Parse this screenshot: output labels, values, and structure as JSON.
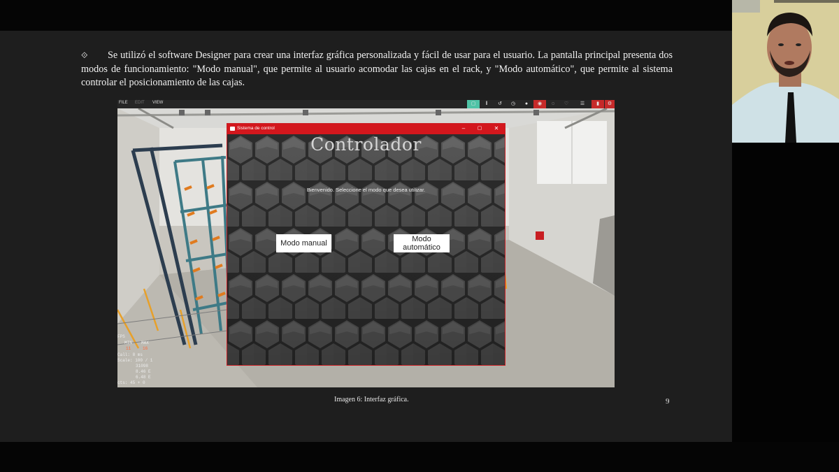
{
  "slide": {
    "bullet_symbol": "⟐",
    "paragraph": "Se utilizó el software Designer para crear una interfaz gráfica personalizada y fácil de usar para el usuario. La pantalla principal presenta dos modos de funcionamiento: \"Modo manual\", que permite al usuario acomodar las cajas en el rack, y \"Modo automático\", que permite al sistema controlar el posicionamiento de las cajas.",
    "caption": "Imagen 6: Interfaz gráfica.",
    "page_number": "9"
  },
  "simulator": {
    "menu": [
      "FILE",
      "EDIT",
      "VIEW"
    ],
    "toolbar_icons": [
      "select-icon",
      "pause-icon",
      "reset-icon",
      "timer-icon",
      "camera-icon",
      "io-icon",
      "sensor-icon",
      "heart-icon",
      "list-icon",
      "settings-icon"
    ],
    "stats": {
      "title": "FPS",
      "min_label": "MIN",
      "max_label": "MAX",
      "min_value": "11",
      "max_value": "16",
      "rows": [
        "Call: 8 ms",
        "Scale: 100 / 1",
        "31098",
        "8.46 E",
        "6.48 E",
        "cts: 45 + 0"
      ]
    }
  },
  "app": {
    "window_title": "Sistema de control",
    "heading": "Controlador",
    "welcome": "Bienvenido. Seleccione el modo que desea utilizar.",
    "manual_button": "Modo manual",
    "auto_button": "Modo automático",
    "accent_color": "#d3171d"
  }
}
